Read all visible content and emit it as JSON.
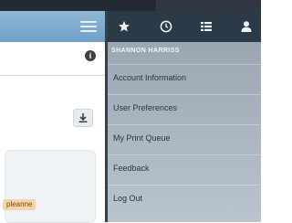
{
  "user_menu": {
    "user_name": "SHANNON HARRISS",
    "items": [
      {
        "label": "Account Information"
      },
      {
        "label": "User Preferences"
      },
      {
        "label": "My Print Queue"
      },
      {
        "label": "Feedback"
      },
      {
        "label": "Log Out"
      }
    ]
  },
  "page": {
    "tag_label": "pleanne"
  },
  "icons": {
    "top_bar": [
      "star-icon",
      "clock-icon",
      "list-icon",
      "user-icon"
    ],
    "left_header": "hamburger-menu-icon",
    "info": "info-icon",
    "download": "download-icon"
  },
  "colors": {
    "header_blue": "#7aa8cf",
    "menu_dark": "#2b3a47",
    "menu_bg": "#a9b5c0"
  }
}
